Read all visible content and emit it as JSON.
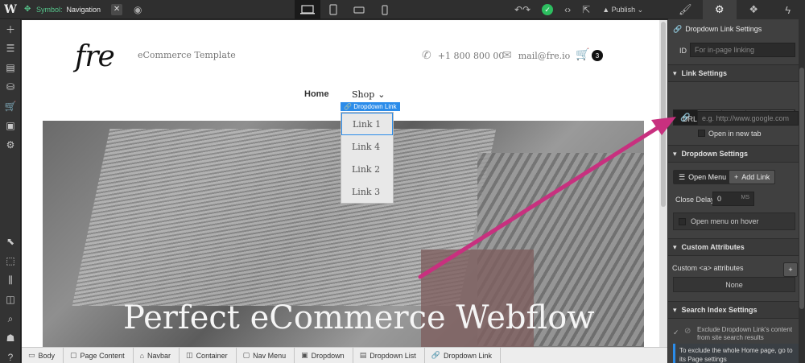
{
  "topbar": {
    "logo": "W",
    "symbol_label": "Symbol:",
    "symbol_name": "Navigation",
    "publish_label": "Publish"
  },
  "canvas": {
    "brand": "fre",
    "brand_sub": "eCommerce Template",
    "phone": "+1 800 800 00",
    "email": "mail@fre.io",
    "cart_count": "3",
    "nav_home": "Home",
    "nav_shop": "Shop",
    "dropdown_tag": "Dropdown Link",
    "dropdown_items": [
      "Link 1",
      "Link 4",
      "Link 2",
      "Link 3"
    ],
    "hero_title": "Perfect eCommerce Webflow"
  },
  "breadcrumb": [
    "Body",
    "Page Content",
    "Navbar",
    "Container",
    "Nav Menu",
    "Dropdown",
    "Dropdown List",
    "Dropdown Link"
  ],
  "panel": {
    "header": "Dropdown Link Settings",
    "id_label": "ID",
    "id_placeholder": "For in-page linking",
    "link_settings": "Link Settings",
    "url_label": "URL",
    "url_placeholder": "e.g. http://www.google.com",
    "open_new_tab": "Open in new tab",
    "dropdown_settings": "Dropdown Settings",
    "open_menu": "Open Menu",
    "add_link": "Add Link",
    "close_delay_label": "Close Delay",
    "close_delay_value": "0",
    "close_delay_unit": "MS",
    "open_on_hover": "Open menu on hover",
    "custom_attributes": "Custom Attributes",
    "custom_a_label": "Custom <a> attributes",
    "none_label": "None",
    "search_index": "Search Index Settings",
    "exclude_text": "Exclude Dropdown Link's content from site search results",
    "note_text": "To exclude the whole Home page, go to its Page settings"
  },
  "colors": {
    "accent": "#2b8cea",
    "symbol_green": "#57c78d",
    "arrow_magenta": "#c8307f"
  }
}
